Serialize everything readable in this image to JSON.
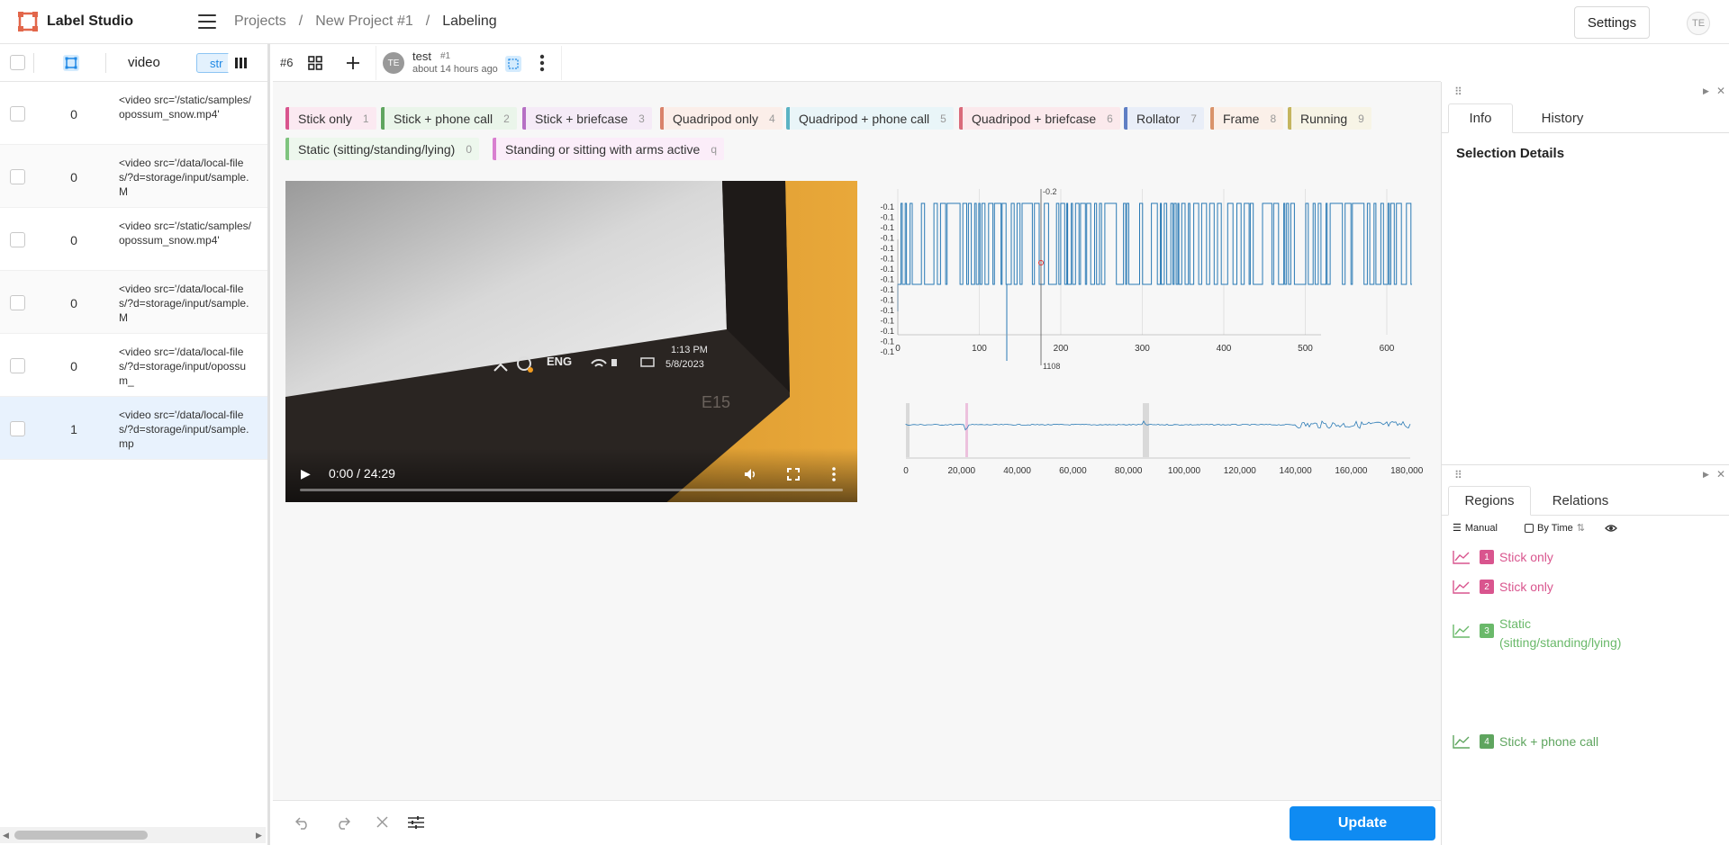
{
  "header": {
    "app_name": "Label Studio",
    "breadcrumb": [
      "Projects",
      "New Project #1",
      "Labeling"
    ],
    "separator": "/",
    "settings_label": "Settings",
    "avatar": "TE"
  },
  "left_panel": {
    "column_header": "video",
    "filter_chip": "str",
    "rows": [
      {
        "num": "0",
        "text": "<video src='/static/samples/opossum_snow.mp4'",
        "selected": false
      },
      {
        "num": "0",
        "text": "<video src='/data/local-files/?d=storage/input/sample.M",
        "selected": false
      },
      {
        "num": "0",
        "text": "<video src='/static/samples/opossum_snow.mp4'",
        "selected": false
      },
      {
        "num": "0",
        "text": "<video src='/data/local-files/?d=storage/input/sample.M",
        "selected": false
      },
      {
        "num": "0",
        "text": "<video src='/data/local-files/?d=storage/input/opossum_",
        "selected": false
      },
      {
        "num": "1",
        "text": "<video src='/data/local-files/?d=storage/input/sample.mp",
        "selected": true
      }
    ]
  },
  "toolbar": {
    "task_id": "#6",
    "user_avatar": "TE",
    "user_name": "test",
    "annotation_id": "#1",
    "timestamp": "about 14 hours ago"
  },
  "labels": [
    {
      "text": "Stick only",
      "key": "1",
      "color": "#d9558e",
      "bg": "#fbe9f1"
    },
    {
      "text": "Stick + phone call",
      "key": "2",
      "color": "#5fa55f",
      "bg": "#eaf5ea"
    },
    {
      "text": "Stick + briefcase",
      "key": "3",
      "color": "#b670c4",
      "bg": "#f5ebf7"
    },
    {
      "text": "Quadripod only",
      "key": "4",
      "color": "#d9826a",
      "bg": "#fbeee9"
    },
    {
      "text": "Quadripod + phone call",
      "key": "5",
      "color": "#5bb3c4",
      "bg": "#e9f5f8"
    },
    {
      "text": "Quadripod + briefcase",
      "key": "6",
      "color": "#d96a7a",
      "bg": "#fbe9ec"
    },
    {
      "text": "Rollator",
      "key": "7",
      "color": "#5f7fc4",
      "bg": "#e9eef8"
    },
    {
      "text": "Frame",
      "key": "8",
      "color": "#d9936a",
      "bg": "#fbf0e9"
    },
    {
      "text": "Running",
      "key": "9",
      "color": "#c4b55f",
      "bg": "#f7f4e6"
    },
    {
      "text": "Static (sitting/standing/lying)",
      "key": "0",
      "color": "#7fc47f",
      "bg": "#edf7ed"
    },
    {
      "text": "Standing or sitting with arms active",
      "key": "q",
      "color": "#d97fd0",
      "bg": "#fbedf9"
    }
  ],
  "video": {
    "time": "0:00 / 24:29",
    "overlay_lang": "ENG",
    "overlay_time": "1:13 PM",
    "overlay_date": "5/8/2023",
    "overlay_model": "E15"
  },
  "timeseries": {
    "y_tick_labels": [
      "-0.1",
      "-0.1",
      "-0.1",
      "-0.1",
      "-0.1",
      "-0.1",
      "-0.1",
      "-0.1",
      "-0.1",
      "-0.1",
      "-0.1",
      "-0.1",
      "-0.1",
      "-0.1",
      "-0.1"
    ],
    "cursor_top": "-0.2",
    "cursor_bottom": "1108",
    "x_ticks": [
      "0",
      "100",
      "200",
      "300",
      "400",
      "500",
      "600"
    ],
    "overview_ticks": [
      "0",
      "20,000",
      "40,000",
      "60,000",
      "80,000",
      "100,000",
      "120,000",
      "140,000",
      "160,000",
      "180,000"
    ]
  },
  "right_panel": {
    "tabs_top": [
      "Info",
      "History"
    ],
    "selection_title": "Selection Details",
    "tabs_bottom": [
      "Regions",
      "Relations"
    ],
    "sort_manual": "Manual",
    "sort_time": "By Time",
    "regions": [
      {
        "num": "1",
        "label": "Stick only",
        "color": "#d9558e"
      },
      {
        "num": "2",
        "label": "Stick only",
        "color": "#d9558e"
      },
      {
        "num": "3",
        "label": "Static (sitting/standing/lying)",
        "color": "#6ab96a"
      },
      {
        "num": "4",
        "label": "Stick + phone call",
        "color": "#5fa55f"
      }
    ]
  },
  "footer": {
    "update_label": "Update"
  }
}
